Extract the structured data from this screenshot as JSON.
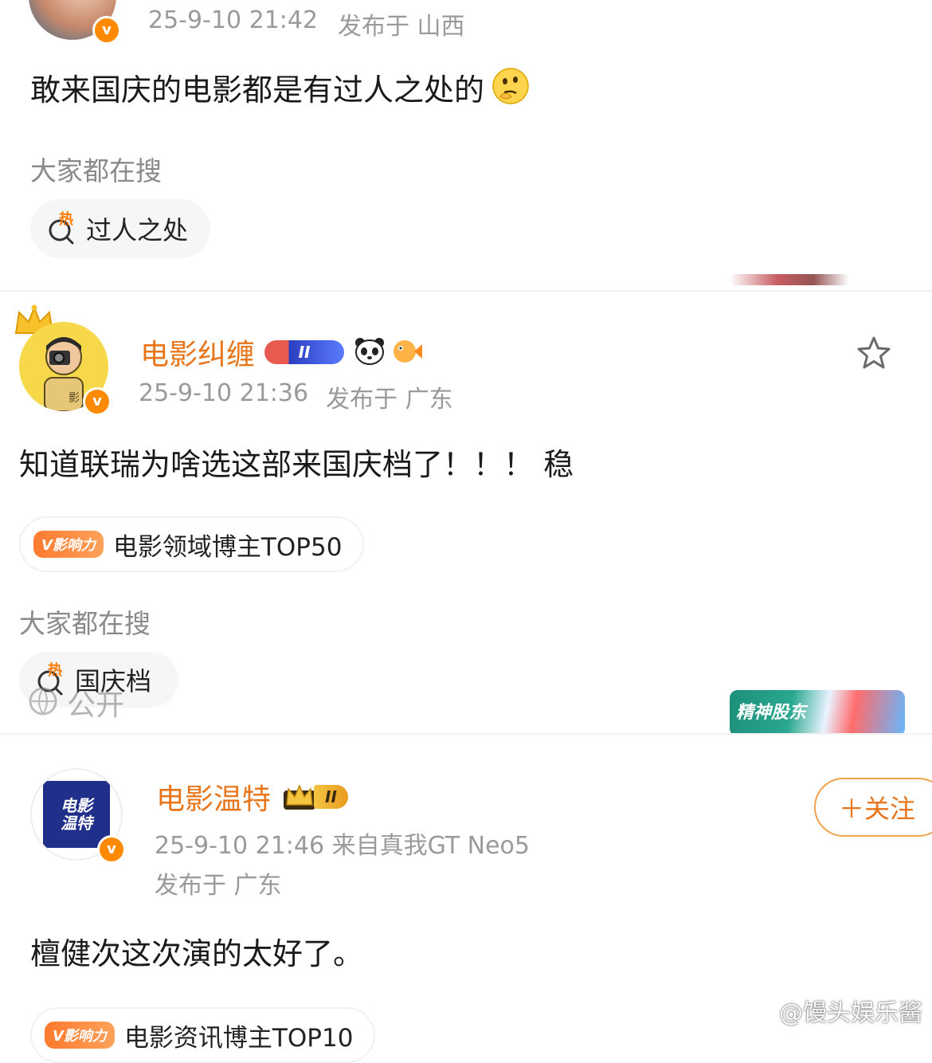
{
  "post1": {
    "timestamp": "25-9-10 21:42",
    "location": "发布于 山西",
    "content": "敢来国庆的电影都是有过人之处的",
    "emoji": "thinking-face-emoji",
    "search_label": "大家都在搜",
    "hot_badge": "热",
    "hot_search": "过人之处"
  },
  "post2": {
    "username": "电影纠缠",
    "level": "II",
    "timestamp": "25-9-10 21:36",
    "location": "发布于 广东",
    "content": "知道联瑞为啥选这部来国庆档了！！！ 稳",
    "influence_tag": "V影响力",
    "influence_text": "电影领域博主TOP50",
    "search_label": "大家都在搜",
    "hot_badge": "热",
    "hot_search": "国庆档",
    "overlay_text": "公开",
    "sticker_text": "精神股东"
  },
  "post3": {
    "username": "电影温特",
    "level": "II",
    "avatar_text": "电影温特",
    "timestamp_device": "25-9-10 21:46  来自真我GT Neo5",
    "location": "发布于 广东",
    "follow_label": "＋关注",
    "content": "檀健次这次演的太好了。",
    "influence_tag": "V影响力",
    "influence_text": "电影资讯博主TOP10"
  },
  "watermark": "@馒头娱乐酱",
  "colors": {
    "username": "#e8751a",
    "verified": "#ff8a00",
    "meta": "#9a9a9a",
    "influence_tag": "#ff7a2e"
  }
}
